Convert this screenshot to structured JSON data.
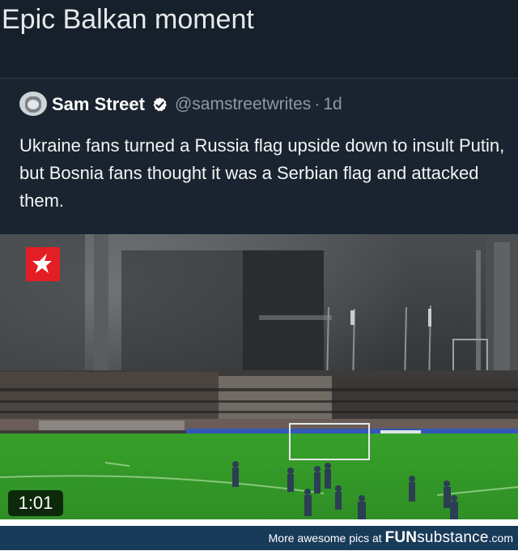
{
  "meme": {
    "title": "Epic Balkan moment"
  },
  "quoted_tweet": {
    "author_name": "Sam Street",
    "handle": "@samstreetwrites",
    "time_ago": "1d",
    "text": "Ukraine fans turned a Russia flag upside down to insult Putin, but Bosnia fans thought it was a Serbian flag and attacked them.",
    "verified_icon": "verified-badge-icon"
  },
  "video": {
    "duration": "1:01",
    "logo_icon": "star-logo-icon"
  },
  "footer": {
    "prefix": "More awesome pics at ",
    "brand_main": "FUN",
    "brand_rest": "substance",
    "brand_domain": ".com"
  },
  "colors": {
    "tweet_background": "#15202b",
    "footer_background": "#193b5a",
    "logo_red": "#e31f25",
    "grass_green": "#3b9a2b"
  }
}
